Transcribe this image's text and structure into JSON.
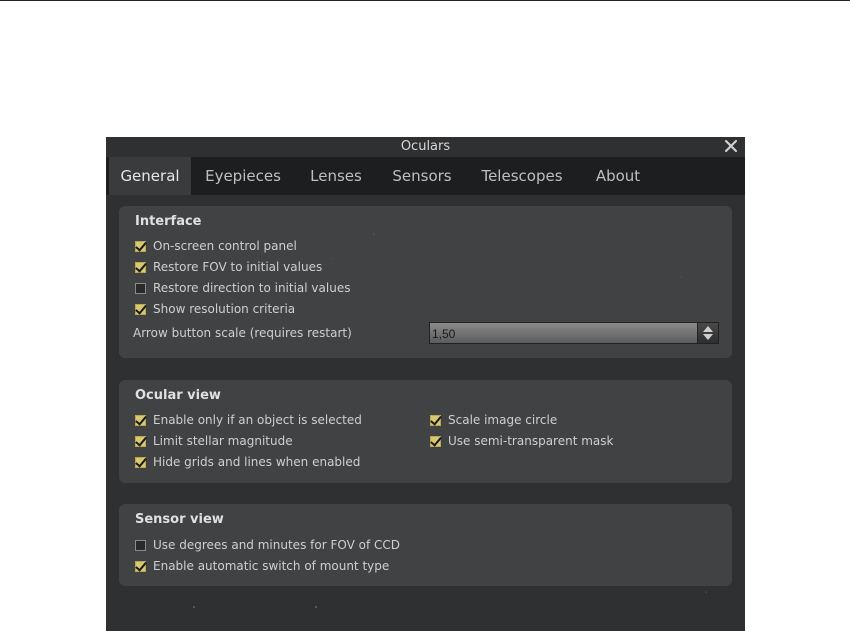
{
  "window": {
    "title": "Oculars"
  },
  "tabs": [
    {
      "label": "General",
      "active": true
    },
    {
      "label": "Eyepieces",
      "active": false
    },
    {
      "label": "Lenses",
      "active": false
    },
    {
      "label": "Sensors",
      "active": false
    },
    {
      "label": "Telescopes",
      "active": false
    },
    {
      "label": "About",
      "active": false
    }
  ],
  "interface": {
    "title": "Interface",
    "checkboxes": [
      {
        "label": "On-screen control panel",
        "checked": true
      },
      {
        "label": "Restore FOV to initial values",
        "checked": true
      },
      {
        "label": "Restore direction to initial values",
        "checked": false
      },
      {
        "label": "Show resolution criteria",
        "checked": true
      }
    ],
    "arrow_scale_label": "Arrow button scale (requires restart)",
    "arrow_scale_value": "1,50"
  },
  "ocular_view": {
    "title": "Ocular view",
    "checkboxes_left": [
      {
        "label": "Enable only if an object is selected",
        "checked": true
      },
      {
        "label": "Limit stellar magnitude",
        "checked": true
      },
      {
        "label": "Hide grids and lines when enabled",
        "checked": true
      }
    ],
    "checkboxes_right": [
      {
        "label": "Scale image circle",
        "checked": true
      },
      {
        "label": "Use semi-transparent mask",
        "checked": true
      }
    ]
  },
  "sensor_view": {
    "title": "Sensor view",
    "checkboxes": [
      {
        "label": "Use degrees and minutes for FOV of CCD",
        "checked": false
      },
      {
        "label": "Enable automatic switch of mount type",
        "checked": true
      }
    ]
  },
  "icons": {
    "close": "close-icon",
    "spin_up": "arrow-up-icon",
    "spin_down": "arrow-down-icon"
  },
  "colors": {
    "dialog_bg": "#2f3032",
    "tabbar_bg": "#1d1e1f",
    "checkbox_checked": "#d8c870",
    "text": "#cfcfcf"
  }
}
